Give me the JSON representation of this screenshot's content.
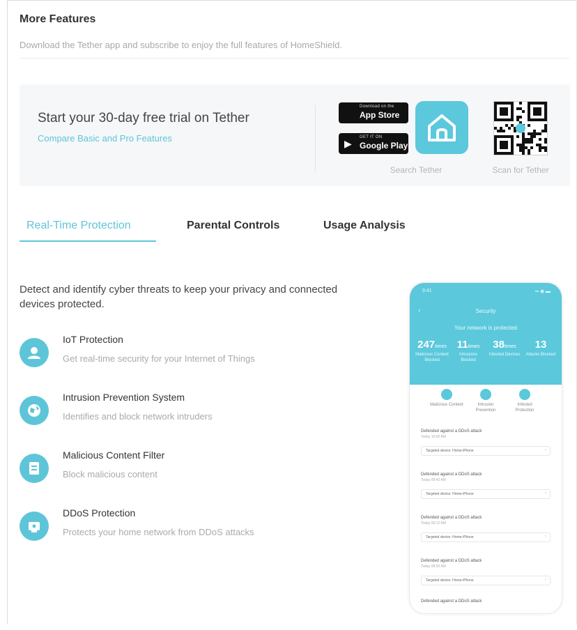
{
  "header": {
    "title": "More Features",
    "subtitle": "Download the Tether app and subscribe to enjoy the full features of HomeShield."
  },
  "trial": {
    "title": "Start your 30-day free trial on Tether",
    "link": "Compare Basic and Pro Features",
    "app_store": {
      "small": "Download on the",
      "big": "App Store"
    },
    "google_play": {
      "small": "GET IT ON",
      "big": "Google Play"
    },
    "search_label": "Search Tether",
    "scan_label": "Scan for Tether"
  },
  "tabs": [
    {
      "label": "Real-Time Protection",
      "active": true
    },
    {
      "label": "Parental Controls",
      "active": false
    },
    {
      "label": "Usage Analysis",
      "active": false
    }
  ],
  "panel": {
    "description": "Detect and identify cyber threats to keep your privacy and connected devices protected.",
    "features": [
      {
        "title": "IoT Protection",
        "desc": "Get real-time security for your Internet of Things",
        "icon": "iot-icon"
      },
      {
        "title": "Intrusion Prevention System",
        "desc": "Identifies and block network intruders",
        "icon": "globe-icon"
      },
      {
        "title": "Malicious Content Filter",
        "desc": "Block malicious content",
        "icon": "filter-icon"
      },
      {
        "title": "DDoS Protection",
        "desc": "Protects your home network from DDoS attacks",
        "icon": "shield-icon"
      }
    ]
  },
  "phone": {
    "status_time": "9:41",
    "status_right": "▪▪ ◉ ▬",
    "title": "Security",
    "subtitle": "Your network is protected",
    "stats": [
      {
        "num": "247",
        "unit": "times",
        "label": "Malicious Content Blocked"
      },
      {
        "num": "11",
        "unit": "times",
        "label": "Intrusions Blocked"
      },
      {
        "num": "38",
        "unit": "times",
        "label": "Infected Devices"
      },
      {
        "num": "13",
        "unit": "",
        "label": "Attacks Blocked"
      }
    ],
    "icons": [
      {
        "label": "Malicious Content"
      },
      {
        "label": "Intrusion Prevention"
      },
      {
        "label": "Infected Protection"
      }
    ],
    "list": [
      {
        "title": "Defended against a DDoS attack",
        "time": "Today 10:00 AM",
        "value": "Targeted device: Home-iPhone"
      },
      {
        "title": "Defended against a DDoS attack",
        "time": "Today 09:42 AM",
        "value": "Targeted device: Home-iPhone"
      },
      {
        "title": "Defended against a DDoS attack",
        "time": "Today 09:12 AM",
        "value": "Targeted device: Home-iPhone"
      },
      {
        "title": "Defended against a DDoS attack",
        "time": "Today 08:50 AM",
        "value": "Targeted device: Home-iPhone"
      },
      {
        "title": "Defended against a DDoS attack",
        "time": "",
        "value": ""
      }
    ]
  },
  "colors": {
    "accent": "#5ec5d9",
    "app_icon": "#5bc8dc",
    "panel_bg": "#f6f7f9"
  }
}
